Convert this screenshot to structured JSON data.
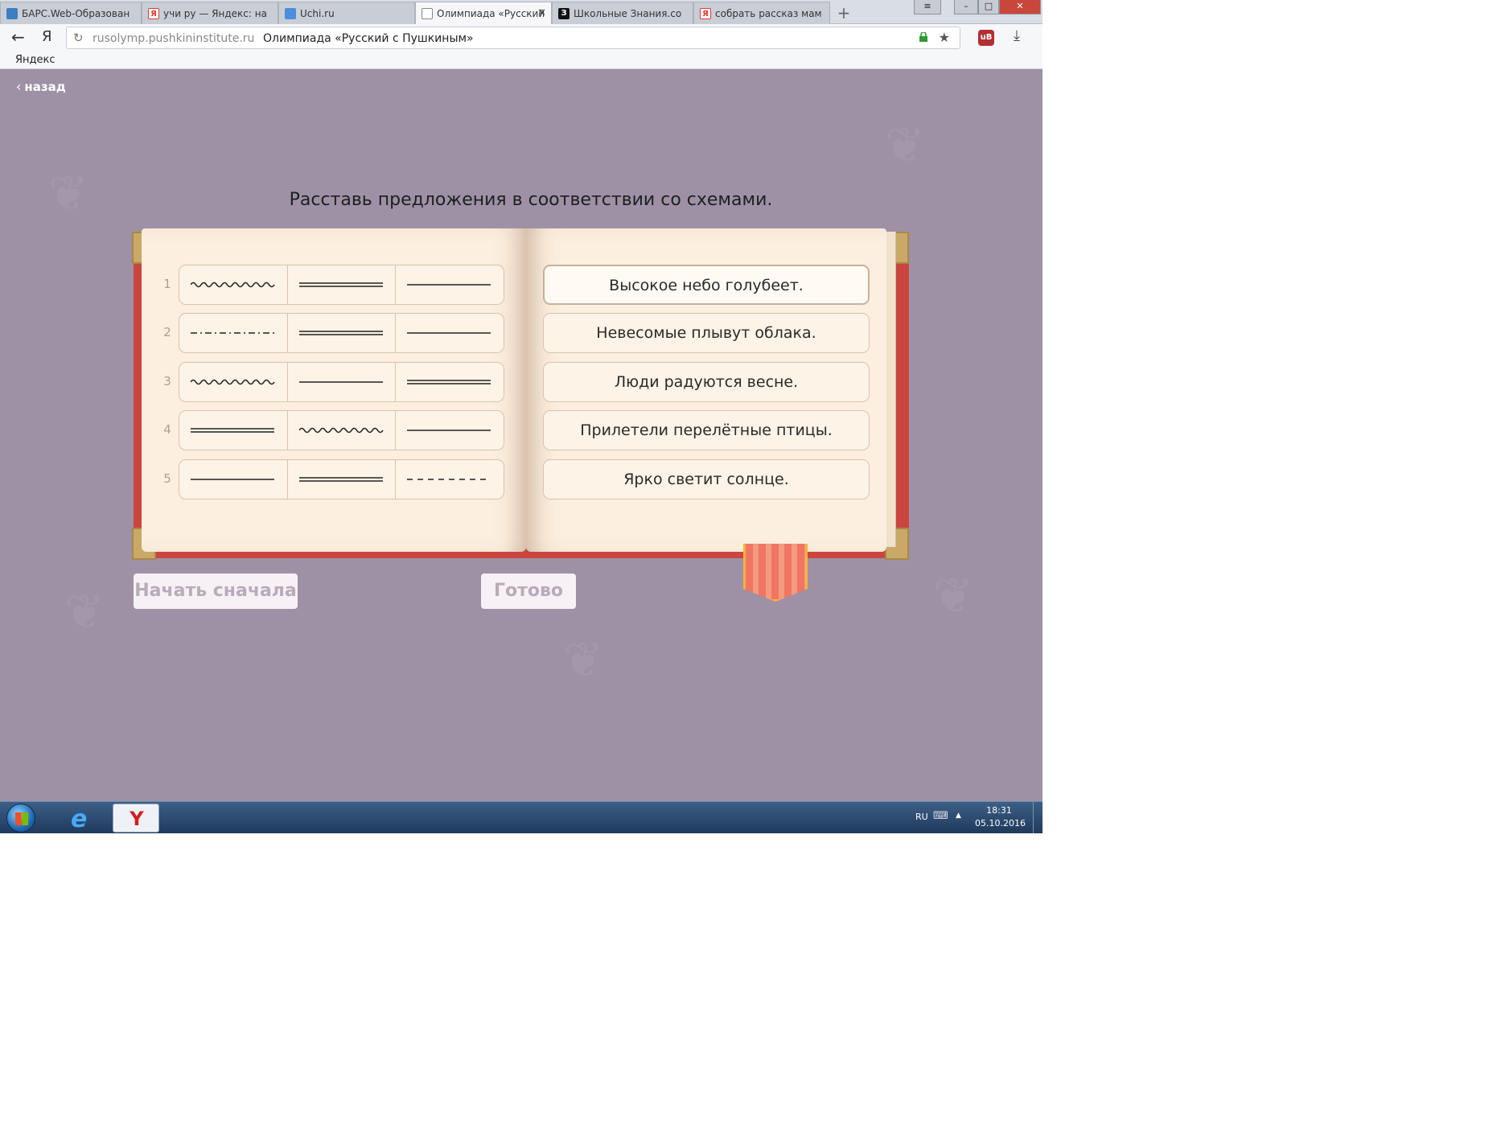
{
  "browser": {
    "tabs": [
      {
        "title": "БАРС.Web-Образован",
        "icon": "bars-icon",
        "color": "#3b7fc4"
      },
      {
        "title": "учи ру — Яндекс: на",
        "icon": "yandex-icon",
        "color": "#e03a2f"
      },
      {
        "title": "Uchi.ru",
        "icon": "uchi-icon",
        "color": "#4a8fd8"
      },
      {
        "title": "Олимпиада «Русский",
        "icon": "page-icon",
        "color": "#ffffff"
      },
      {
        "title": "Школьные Знания.co",
        "icon": "znania-icon",
        "color": "#111111"
      },
      {
        "title": "собрать рассказ мам",
        "icon": "yandex-icon",
        "color": "#e03a2f"
      }
    ],
    "new_tab": "+",
    "window_controls": {
      "menu": "≡",
      "minimize": "–",
      "maximize": "□",
      "close": "✕"
    },
    "back": "←",
    "ya_button": "Я",
    "url_host": "rusolymp.pushkininstitute.ru",
    "url_title": "Олимпиада «Русский с Пушкиным»",
    "bookmarks": [
      "Яндекс"
    ],
    "extension_badge": "uB"
  },
  "page": {
    "back_link": "назад",
    "instruction": "Расставь предложения в соответствии со схемами.",
    "schemes": [
      {
        "number": "1",
        "cells": [
          "wavy",
          "double",
          "single"
        ]
      },
      {
        "number": "2",
        "cells": [
          "dash-dot",
          "double",
          "single"
        ]
      },
      {
        "number": "3",
        "cells": [
          "wavy",
          "single",
          "double"
        ]
      },
      {
        "number": "4",
        "cells": [
          "double",
          "wavy",
          "single"
        ]
      },
      {
        "number": "5",
        "cells": [
          "single",
          "double",
          "dashed"
        ]
      }
    ],
    "sentences": [
      {
        "text": "Высокое небо голубеет.",
        "selected": true
      },
      {
        "text": "Невесомые плывут облака.",
        "selected": false
      },
      {
        "text": "Люди радуются весне.",
        "selected": false
      },
      {
        "text": "Прилетели перелётные птицы.",
        "selected": false
      },
      {
        "text": "Ярко светит солнце.",
        "selected": false
      }
    ],
    "buttons": {
      "restart": "Начать сначала",
      "done": "Готово"
    },
    "colors": {
      "background": "#9e91a6",
      "book_cover": "#c9453e",
      "paper": "#fcefdf",
      "ribbon": "#f07563"
    }
  },
  "taskbar": {
    "pinned": [
      "start-button",
      "internet-explorer-icon",
      "yandex-browser-icon"
    ],
    "language": "RU",
    "time": "18:31",
    "date": "05.10.2016"
  }
}
